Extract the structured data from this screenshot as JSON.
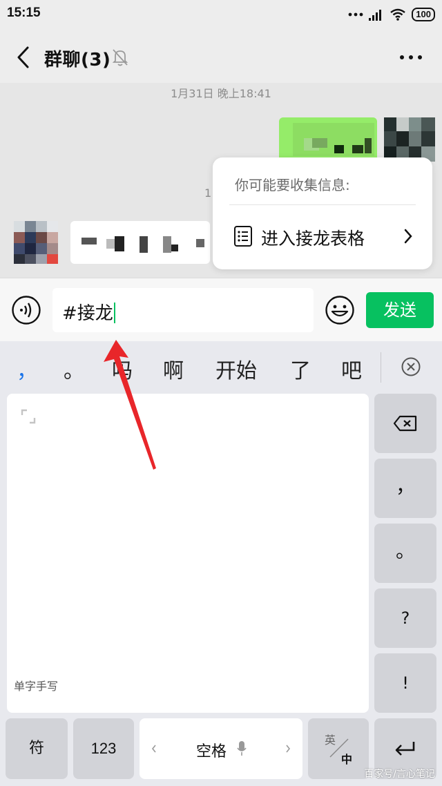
{
  "status_bar": {
    "time": "15:15",
    "battery": "100"
  },
  "header": {
    "title": "群聊(3)"
  },
  "chat": {
    "timestamp": "1月31日 晚上18:41",
    "partial_timestamp": "1"
  },
  "popup": {
    "hint": "你可能要收集信息:",
    "action_label": "进入接龙表格"
  },
  "input": {
    "value": "#接龙",
    "send_label": "发送"
  },
  "candidates": [
    "，",
    "。",
    "吗",
    "啊",
    "开始",
    "了",
    "吧"
  ],
  "keyboard": {
    "handwriting_label": "单字手写",
    "side_keys": [
      "，",
      "。",
      "?",
      "!"
    ],
    "bottom": {
      "symbols": "符",
      "numbers": "123",
      "space": "空格",
      "lang_top": "英",
      "lang_bottom": "中"
    }
  },
  "watermark": "百家号/言心笔记",
  "colors": {
    "accent": "#07c160",
    "arrow": "#e8262a"
  }
}
